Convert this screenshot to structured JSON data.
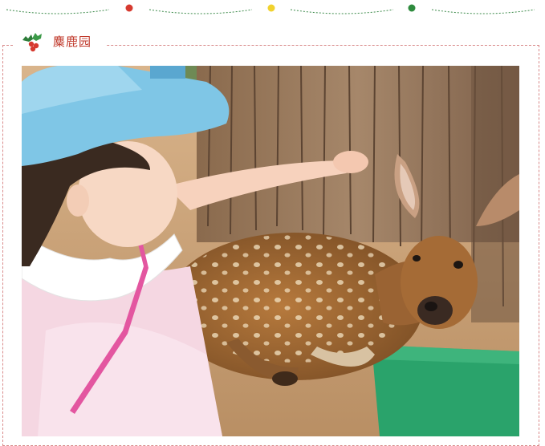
{
  "section": {
    "title": "麋鹿园",
    "icon": "holly-icon"
  },
  "garland": {
    "ornament_colors": [
      "#d63a2f",
      "#f1d22e",
      "#2e8b3e"
    ]
  },
  "photo": {
    "subject": "child-feeding-deer-photo"
  }
}
